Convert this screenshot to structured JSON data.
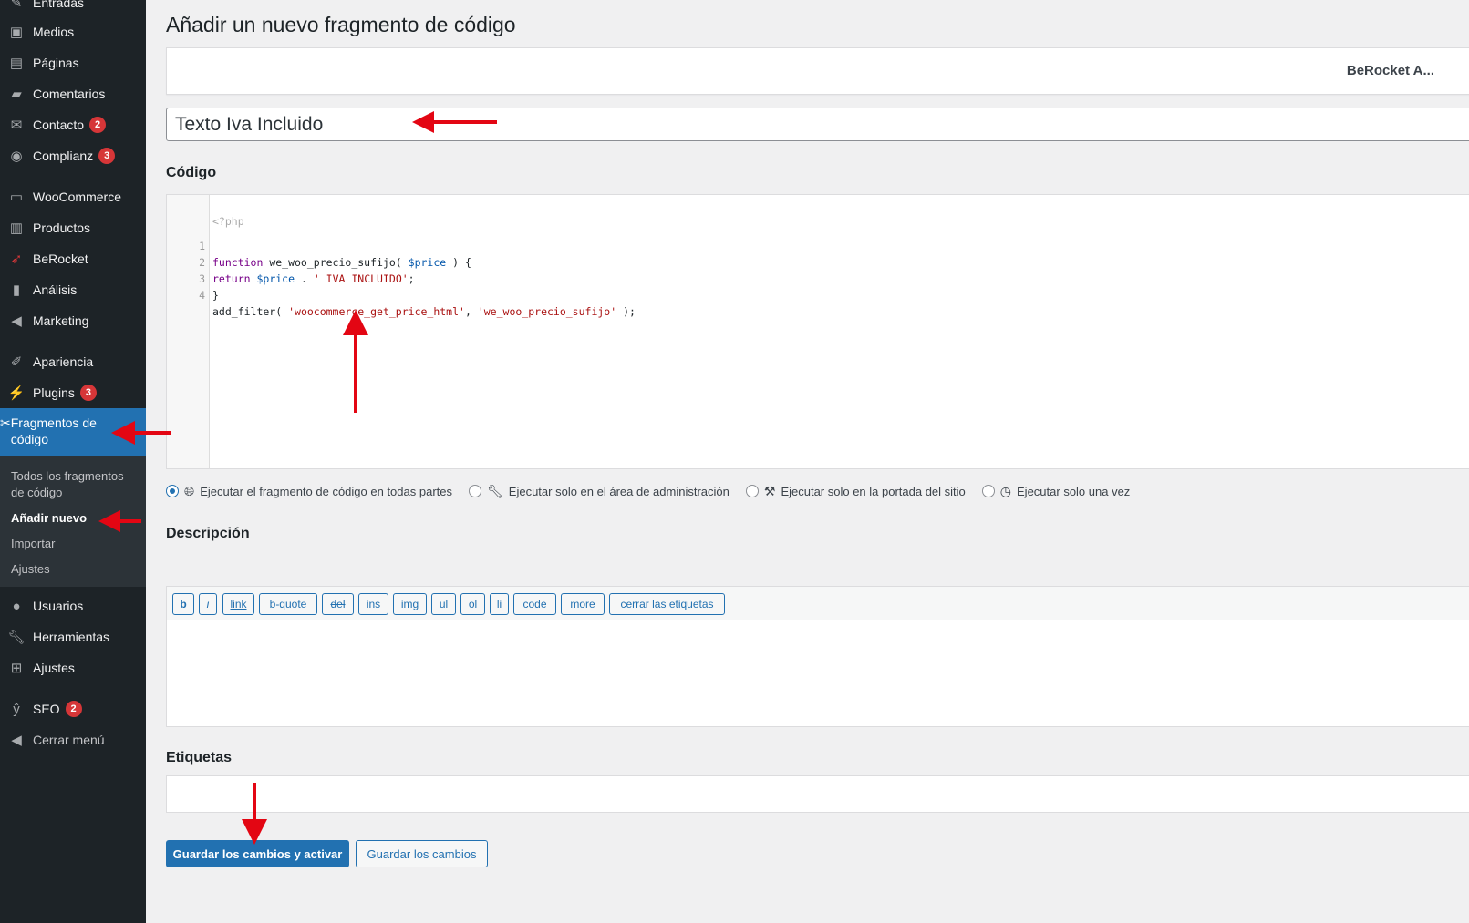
{
  "sidebar": {
    "items": [
      {
        "label": "Entradas",
        "icon": "pin-icon"
      },
      {
        "label": "Medios",
        "icon": "media-icon"
      },
      {
        "label": "Páginas",
        "icon": "page-icon"
      },
      {
        "label": "Comentarios",
        "icon": "comment-icon"
      },
      {
        "label": "Contacto",
        "icon": "mail-icon",
        "badge": "2"
      },
      {
        "label": "Complianz",
        "icon": "complianz-icon",
        "badge": "3"
      },
      {
        "label": "WooCommerce",
        "icon": "woo-icon"
      },
      {
        "label": "Productos",
        "icon": "archive-icon"
      },
      {
        "label": "BeRocket",
        "icon": "rocket-icon"
      },
      {
        "label": "Análisis",
        "icon": "chart-icon"
      },
      {
        "label": "Marketing",
        "icon": "megaphone-icon"
      },
      {
        "label": "Apariencia",
        "icon": "brush-icon"
      },
      {
        "label": "Plugins",
        "icon": "plugin-icon",
        "badge": "3"
      },
      {
        "label": "Usuarios",
        "icon": "user-icon"
      },
      {
        "label": "Herramientas",
        "icon": "wrench-icon"
      },
      {
        "label": "Ajustes",
        "icon": "settings-icon"
      },
      {
        "label": "SEO",
        "icon": "yoast-icon",
        "badge": "2"
      },
      {
        "label": "Cerrar menú",
        "icon": "collapse-icon"
      }
    ],
    "active": {
      "label": "Fragmentos de código",
      "icon": "scissors-icon"
    },
    "submenu": [
      {
        "label": "Todos los fragmentos de código"
      },
      {
        "label": "Añadir nuevo"
      },
      {
        "label": "Importar"
      },
      {
        "label": "Ajustes"
      }
    ]
  },
  "main": {
    "page_title": "Añadir un nuevo fragmento de código",
    "notice_text": "BeRocket A...",
    "title_value": "Texto Iva Incluido",
    "code_heading": "Código",
    "code_open_tag": "<?php",
    "code_lines": [
      {
        "n": "1",
        "text": "function we_woo_precio_sufijo( $price ) {"
      },
      {
        "n": "2",
        "text": "return $price . ' IVA INCLUIDO';"
      },
      {
        "n": "3",
        "text": "}"
      },
      {
        "n": "4",
        "text": "add_filter( 'woocommerce_get_price_html', 'we_woo_precio_sufijo' );"
      }
    ],
    "scope_options": [
      {
        "label": "Ejecutar el fragmento de código en todas partes",
        "icon": "globe-icon",
        "checked": true
      },
      {
        "label": "Ejecutar solo en el área de administración",
        "icon": "wrench-icon",
        "checked": false
      },
      {
        "label": "Ejecutar solo en la portada del sitio",
        "icon": "hammer-icon",
        "checked": false
      },
      {
        "label": "Ejecutar solo una vez",
        "icon": "clock-icon",
        "checked": false
      }
    ],
    "description_heading": "Descripción",
    "quicktags": [
      "b",
      "i",
      "link",
      "b-quote",
      "del",
      "ins",
      "img",
      "ul",
      "ol",
      "li",
      "code",
      "more",
      "cerrar las etiquetas"
    ],
    "tags_heading": "Etiquetas",
    "save_activate_label": "Guardar los cambios y activar",
    "save_label": "Guardar los cambios"
  },
  "colors": {
    "accent": "#2271b1",
    "sidebar": "#1d2327",
    "annotation_arrow": "#e30613"
  }
}
